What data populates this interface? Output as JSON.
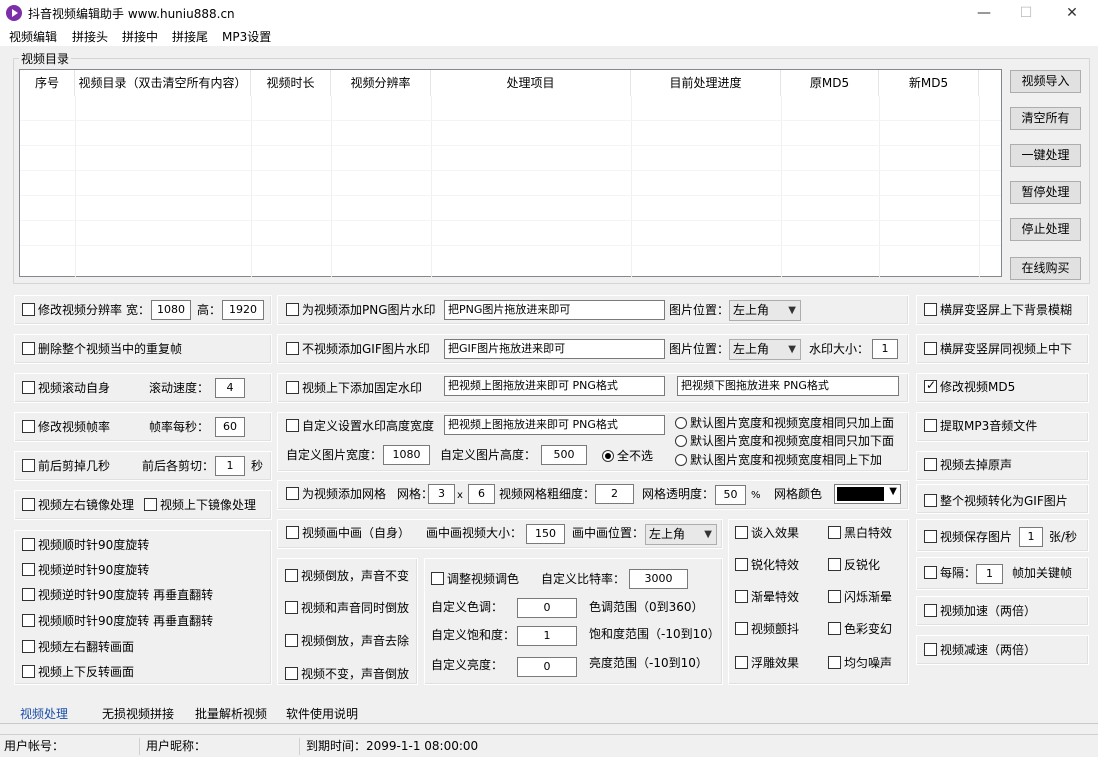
{
  "window": {
    "title": "抖音视频编辑助手  www.huniu888.cn",
    "minimize": "—",
    "maximize": "☐",
    "close": "✕"
  },
  "menu": [
    "视频编辑",
    "拼接头",
    "拼接中",
    "拼接尾",
    "MP3设置"
  ],
  "video_dir": {
    "legend": "视频目录",
    "columns": [
      "序号",
      "视频目录（双击清空所有内容）",
      "视频时长",
      "视频分辨率",
      "处理项目",
      "目前处理进度",
      "原MD5",
      "新MD5"
    ]
  },
  "side_buttons": [
    "视频导入",
    "清空所有",
    "一键处理",
    "暂停处理",
    "停止处理",
    "在线购买"
  ],
  "left_opts": {
    "resize": {
      "label": "修改视频分辨率",
      "w_label": "宽：",
      "w": "1080",
      "h_label": "高：",
      "h": "1920"
    },
    "dedup": {
      "label": "删除整个视频当中的重复帧"
    },
    "scroll": {
      "label": "视频滚动自身",
      "speed_label": "滚动速度：",
      "speed": "4"
    },
    "fps": {
      "label": "修改视频帧率",
      "fps_label": "帧率每秒：",
      "fps": "60"
    },
    "trim": {
      "label": "前后剪掉几秒",
      "trim_label": "前后各剪切：",
      "trim": "1",
      "unit": "秒"
    },
    "mirror_lr": "视频左右镜像处理",
    "mirror_ud": "视频上下镜像处理",
    "rotate": [
      "视频顺时针90度旋转",
      "视频逆时针90度旋转",
      "视频逆时针90度旋转 再垂直翻转",
      "视频顺时针90度旋转 再垂直翻转",
      "视频左右翻转画面",
      "视频上下反转画面"
    ]
  },
  "mid_opts": {
    "png": {
      "label": "为视频添加PNG图片水印",
      "hint": "把PNG图片拖放进来即可",
      "pos_label": "图片位置：",
      "pos": "左上角"
    },
    "gif": {
      "label": "不视频添加GIF图片水印",
      "hint": "把GIF图片拖放进来即可",
      "pos_label": "图片位置：",
      "pos": "左上角",
      "size_label": "水印大小：",
      "size": "1"
    },
    "fixed": {
      "label": "视频上下添加固定水印",
      "top_hint": "把视频上图拖放进来即可 PNG格式",
      "bottom_hint": "把视频下图拖放进来  PNG格式"
    },
    "custom": {
      "label": "自定义设置水印高度宽度",
      "hint": "把视频上图拖放进来即可 PNG格式",
      "w_label": "自定义图片宽度：",
      "w": "1080",
      "h_label": "自定义图片高度：",
      "h": "500",
      "radios": [
        "默认图片宽度和视频宽度相同只加上面",
        "默认图片宽度和视频宽度相同只加下面",
        "全不选",
        "默认图片宽度和视频宽度相同上下加"
      ]
    },
    "grid": {
      "label": "为视频添加网格",
      "grid_label": "网格：",
      "gx": "3",
      "x": "x",
      "gy": "6",
      "thick_label": "视频网格粗细度：",
      "thick": "2",
      "alpha_label": "网格透明度：",
      "alpha": "50",
      "pct": "%",
      "color_label": "网格颜色",
      "color": "#000000"
    },
    "pip": {
      "label": "视频画中画（自身）",
      "size_label": "画中画视频大小：",
      "size": "150",
      "pos_label": "画中画位置：",
      "pos": "左上角"
    },
    "reverse": [
      "视频倒放，声音不变",
      "视频和声音同时倒放",
      "视频倒放，声音去除",
      "视频不变，声音倒放"
    ],
    "color": {
      "label": "调整视频调色",
      "bitrate_label": "自定义比特率：",
      "bitrate": "3000",
      "hue_label": "自定义色调：",
      "hue": "0",
      "hue_range": "色调范围（0到360）",
      "sat_label": "自定义饱和度：",
      "sat": "1",
      "sat_range": "饱和度范围（-10到10）",
      "bri_label": "自定义亮度：",
      "bri": "0",
      "bri_range": "亮度范围（-10到10）"
    },
    "effects": [
      "谈入效果",
      "黑白特效",
      "锐化特效",
      "反锐化",
      "渐晕特效",
      "闪烁渐晕",
      "视频颤抖",
      "色彩变幻",
      "浮雕效果",
      "均匀噪声"
    ]
  },
  "right_opts": {
    "blur": "横屏变竖屏上下背景模糊",
    "same": "横屏变竖屏同视频上中下",
    "md5": "修改视频MD5",
    "mp3": "提取MP3音频文件",
    "mute": "视频去掉原声",
    "gif": "整个视频转化为GIF图片",
    "save": {
      "label": "视频保存图片",
      "val": "1",
      "unit": "张/秒"
    },
    "key": {
      "label": "每隔：",
      "val": "1",
      "unit": "帧加关键帧"
    },
    "fast": "视频加速（两倍）",
    "slow": "视频减速（两倍）"
  },
  "tabs": [
    "视频处理",
    "无损视频拼接",
    "批量解析视频",
    "软件使用说明"
  ],
  "status": {
    "account": "用户帐号：",
    "nick": "用户昵称：",
    "expire": "到期时间：",
    "expire_val": "2099-1-1 08:00:00"
  }
}
